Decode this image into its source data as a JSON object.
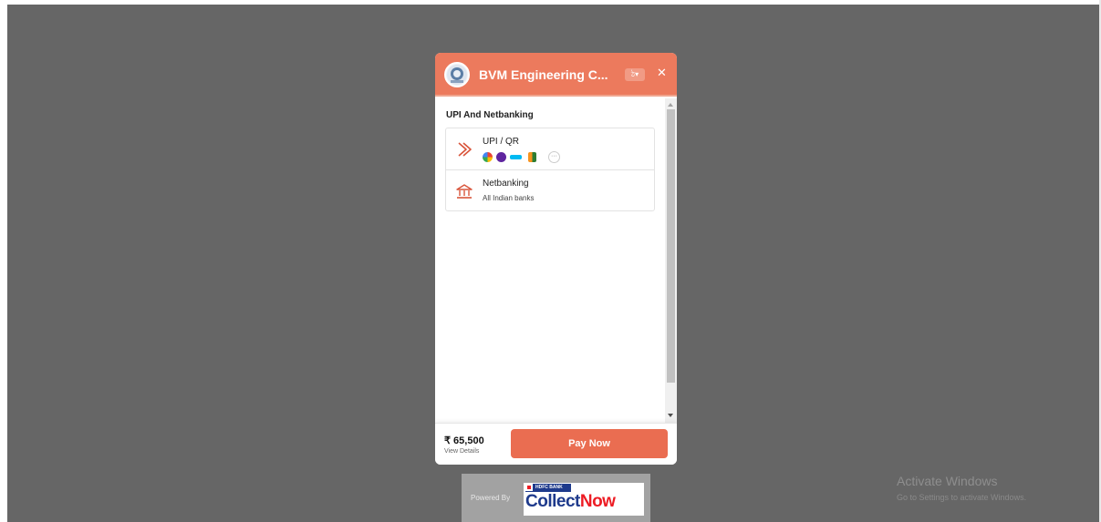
{
  "merchant": {
    "name": "BVM Engineering C...",
    "lang_label": "ঠ▾"
  },
  "section": {
    "title": "UPI And Netbanking"
  },
  "payment_methods": [
    {
      "title": "UPI / QR",
      "icon": "upi-arrow-icon",
      "apps": [
        "google-pay",
        "phonepe",
        "paytm",
        "bhim"
      ],
      "more_label": "···"
    },
    {
      "title": "Netbanking",
      "subtitle": "All Indian banks",
      "icon": "bank-icon"
    }
  ],
  "footer": {
    "amount": "₹ 65,500",
    "view_details": "View Details",
    "pay_label": "Pay Now"
  },
  "powered": {
    "label": "Powered By",
    "bank": "HDFC BANK",
    "product": "Collect",
    "product_suffix": "Now"
  },
  "watermark": {
    "title": "Activate Windows",
    "subtitle": "Go to Settings to activate Windows."
  },
  "colors": {
    "header": "#ec7a5d",
    "accent": "#ea6d51",
    "backdrop": "#666666",
    "hdfc_blue": "#1e3a8c",
    "hdfc_red": "#ed1c24"
  }
}
